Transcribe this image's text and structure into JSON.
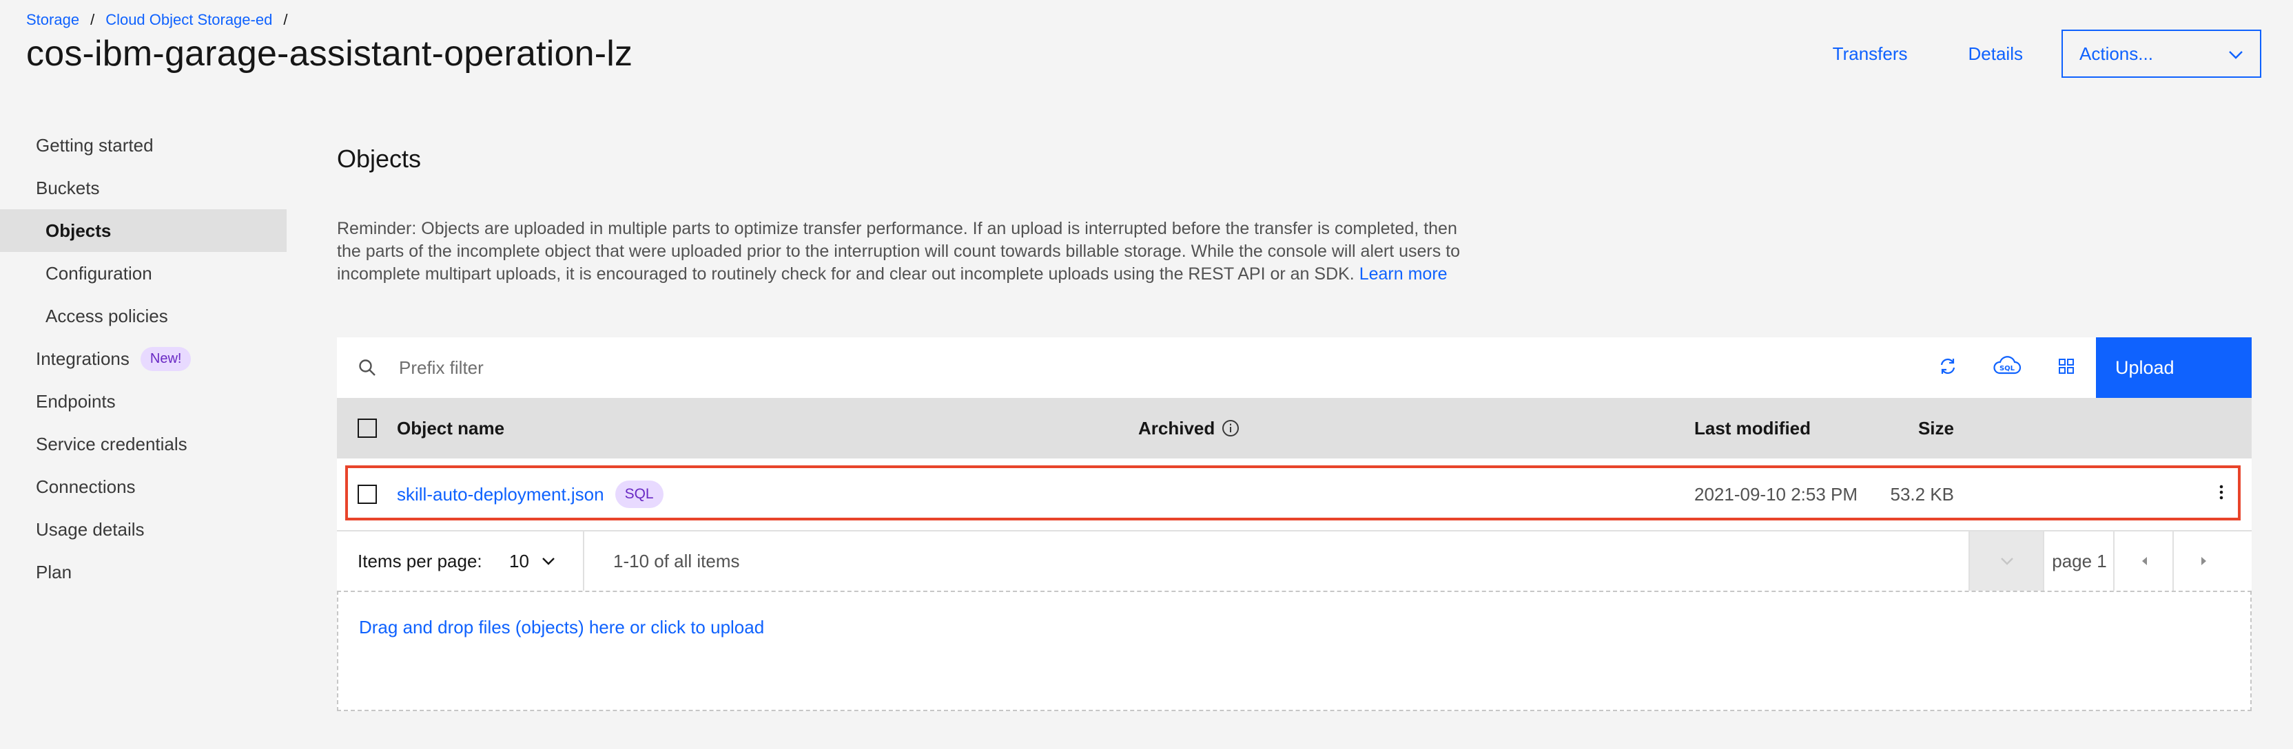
{
  "breadcrumb": {
    "items": [
      {
        "label": "Storage"
      },
      {
        "label": "Cloud Object Storage-ed"
      }
    ],
    "separator": "/"
  },
  "page_title": "cos-ibm-garage-assistant-operation-lz",
  "header": {
    "transfers_label": "Transfers",
    "details_label": "Details",
    "actions_label": "Actions..."
  },
  "sidebar": {
    "items": [
      {
        "label": "Getting started"
      },
      {
        "label": "Buckets"
      },
      {
        "label": "Objects",
        "active": true
      },
      {
        "label": "Configuration"
      },
      {
        "label": "Access policies"
      },
      {
        "label": "Integrations",
        "badge": "New!"
      },
      {
        "label": "Endpoints"
      },
      {
        "label": "Service credentials"
      },
      {
        "label": "Connections"
      },
      {
        "label": "Usage details"
      },
      {
        "label": "Plan"
      }
    ]
  },
  "main": {
    "section_title": "Objects",
    "reminder_text": "Reminder: Objects are uploaded in multiple parts to optimize transfer performance. If an upload is interrupted before the transfer is completed, then the parts of the incomplete object that were uploaded prior to the interruption will count towards billable storage. While the console will alert users to incomplete multipart uploads, it is encouraged to routinely check for and clear out incomplete uploads using the REST API or an SDK.",
    "learn_more_label": "Learn more",
    "search_placeholder": "Prefix filter",
    "upload_label": "Upload",
    "table": {
      "headers": {
        "name": "Object name",
        "archived": "Archived",
        "size": "Size",
        "last_modified": "Last modified"
      },
      "rows": [
        {
          "name": "skill-auto-deployment.json",
          "tag": "SQL",
          "size": "53.2 KB",
          "last_modified": "2021-09-10 2:53 PM"
        }
      ]
    },
    "pagination": {
      "items_per_page_label": "Items per page:",
      "items_per_page_value": "10",
      "range_text": "1-10 of all items",
      "page_label": "page 1"
    },
    "dropzone_text": "Drag and drop files (objects) here or click to upload"
  },
  "colors": {
    "accent": "#0f62fe",
    "tag_bg": "#e8daff",
    "tag_text": "#6929c4",
    "highlight": "#e8442b"
  }
}
